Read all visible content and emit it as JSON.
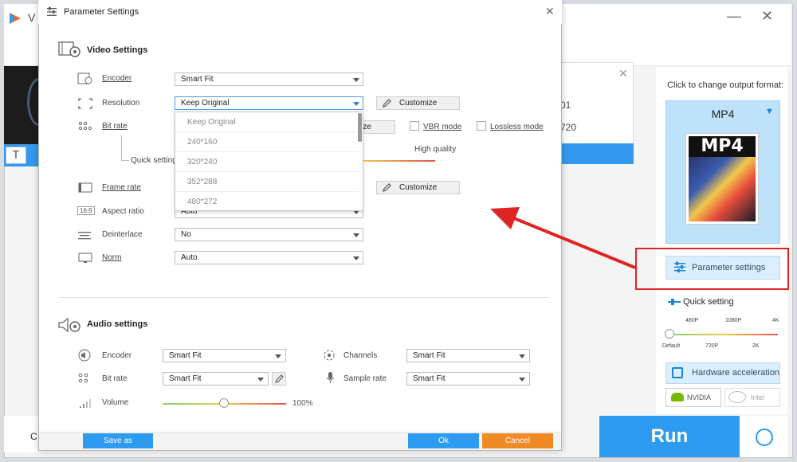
{
  "app": {
    "title_fragment": "V",
    "minimize": "—",
    "close": "✕",
    "file_card_close": "✕",
    "file_value_1": "01",
    "file_value_2": "720",
    "preview_letter": "T",
    "bottom_letter": "C"
  },
  "right_panel": {
    "output_label": "Click to change output format:",
    "format_name": "MP4",
    "format_art_text": "MP4",
    "parameter_button": "Parameter settings",
    "quick_label": "Quick setting",
    "quick_top_ticks": [
      "480P",
      "1080P",
      "4K"
    ],
    "quick_bottom_ticks": [
      "Default",
      "720P",
      "2K"
    ],
    "quick_level": 0,
    "hw_label": "Hardware acceleration",
    "nvidia": "NVIDIA",
    "intel": "Intel",
    "run": "Run"
  },
  "dialog": {
    "title": "Parameter Settings",
    "close": "✕",
    "video_heading": "Video Settings",
    "audio_heading": "Audio settings",
    "video": {
      "encoder_label": "Encoder",
      "encoder_value": "Smart Fit",
      "resolution_label": "Resolution",
      "resolution_value": "Keep Original",
      "customize_1": "Customize",
      "bitrate_label": "Bit rate",
      "bitrate_customize_fragment": "ize",
      "vbr_mode": "VBR mode",
      "lossless_mode": "Lossless mode",
      "quick_setting": "Quick setting",
      "high_quality": "High quality",
      "framerate_label": "Frame rate",
      "customize_2": "Customize",
      "aspect_label": "Aspect ratio",
      "aspect_value": "Auto",
      "aspect_icon_text": "16:9",
      "deinterlace_label": "Deinterlace",
      "deinterlace_value": "No",
      "norm_label": "Norm",
      "norm_value": "Auto"
    },
    "resolution_options": [
      "Keep Original",
      "240*160",
      "320*240",
      "352*288",
      "480*272"
    ],
    "audio": {
      "encoder_label": "Encoder",
      "encoder_value": "Smart Fit",
      "bitrate_label": "Bit rate",
      "bitrate_value": "Smart Fit",
      "volume_label": "Volume",
      "volume_value": "100%",
      "channels_label": "Channels",
      "channels_value": "Smart Fit",
      "sample_label": "Sample rate",
      "sample_value": "Smart Fit"
    },
    "save_as": "Save as",
    "ok": "Ok",
    "cancel": "Cancel"
  },
  "colors": {
    "accent": "#2c9bf0",
    "cancel": "#f08a24",
    "highlight": "#e02323",
    "arrow": "#e02323"
  }
}
